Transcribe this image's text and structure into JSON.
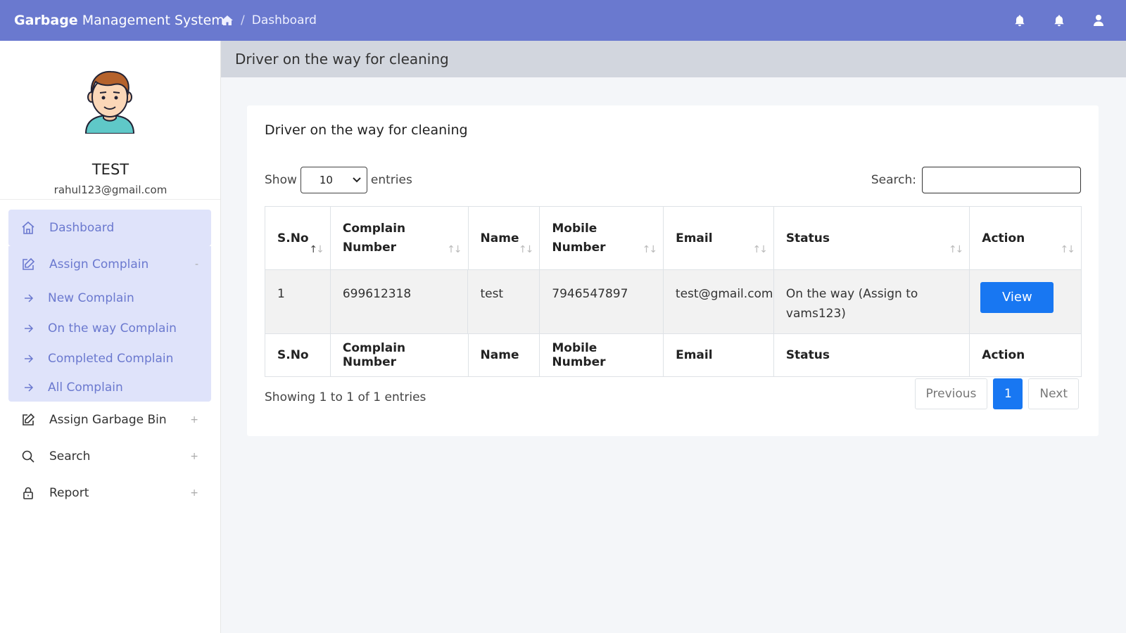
{
  "navbar": {
    "brand_bold": "Garbage",
    "brand_rest": " Management System",
    "breadcrumb_sep": "/",
    "breadcrumb_current": "Dashboard"
  },
  "sidebar": {
    "user_name": "TEST",
    "user_email": "rahul123@gmail.com",
    "menu": {
      "dashboard": "Dashboard",
      "assign_complain": "Assign Complain",
      "assign_complain_toggle": "-",
      "sub": {
        "new_complain": "New Complain",
        "on_the_way_complain": "On the way Complain",
        "completed_complain": "Completed Complain",
        "all_complain": "All Complain"
      },
      "assign_garbage_bin": "Assign Garbage Bin",
      "search": "Search",
      "report": "Report",
      "plus": "+"
    }
  },
  "content_header": {
    "title": "Driver on the way for cleaning"
  },
  "card": {
    "title": "Driver on the way for cleaning",
    "length": {
      "show": "Show",
      "value": "10",
      "entries": "entries"
    },
    "search_label": "Search:",
    "search_value": "",
    "columns": [
      "S.No",
      "Complain Number",
      "Name",
      "Mobile Number",
      "Email",
      "Status",
      "Action"
    ],
    "header_lines": {
      "complain_number": [
        "Complain",
        "Number"
      ],
      "mobile_number": [
        "Mobile",
        "Number"
      ]
    },
    "rows": [
      {
        "sno": "1",
        "complain_number": "699612318",
        "name": "test",
        "mobile": "7946547897",
        "email": "test@gmail.com",
        "status_line1": "On the way (Assign to",
        "status_line2": "vams123)",
        "action": "View"
      }
    ],
    "info": "Showing 1 to 1 of 1 entries",
    "pagination": {
      "previous": "Previous",
      "current": "1",
      "next": "Next"
    }
  },
  "colors": {
    "navbar": "#6a79cf",
    "accent": "#1877f2",
    "menu_highlight": "#dfe3fa"
  },
  "icons": [
    "home-icon",
    "bell-icon",
    "user-icon",
    "avatar-illustration",
    "edit-icon",
    "search-icon",
    "lock-icon",
    "arrow-right-icon"
  ]
}
